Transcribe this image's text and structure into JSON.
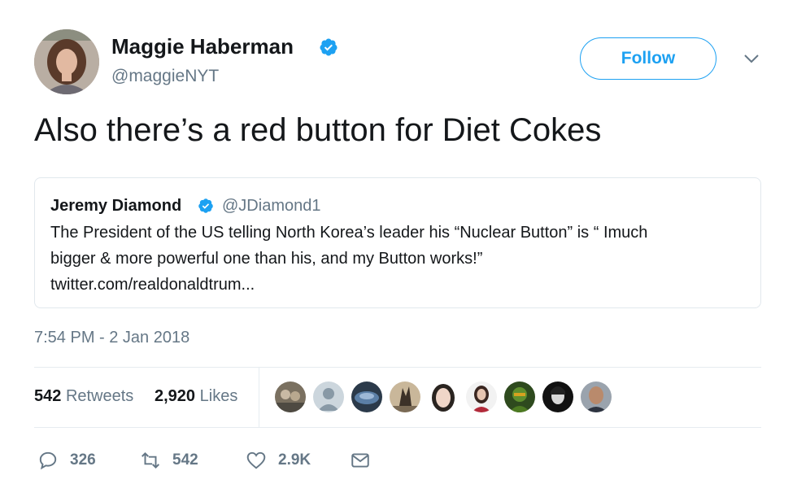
{
  "author": {
    "name": "Maggie Haberman",
    "handle": "@maggieNYT",
    "verified": true
  },
  "follow_label": "Follow",
  "tweet_text": "Also there’s a red button for Diet Cokes",
  "quoted": {
    "name": "Jeremy Diamond",
    "handle": "@JDiamond1",
    "lines": [
      "The President of the US telling North Korea’s leader his  “Nuclear Button” is “ Imuch",
      "bigger & more powerful one than his, and my Button works!”",
      "twitter.com/realdonaldtrum..."
    ]
  },
  "timestamp": "7:54 PM - 2 Jan 2018",
  "stats": {
    "retweets_count": "542",
    "retweets_label": "Retweets",
    "likes_count": "2,920",
    "likes_label": "Likes"
  },
  "actions": {
    "reply_count": "326",
    "retweet_count": "542",
    "like_count": "2.9K"
  },
  "colors": {
    "accent": "#1da1f2",
    "secondary_text": "#657786",
    "border": "#e1e8ed",
    "primary_text": "#14171a"
  }
}
